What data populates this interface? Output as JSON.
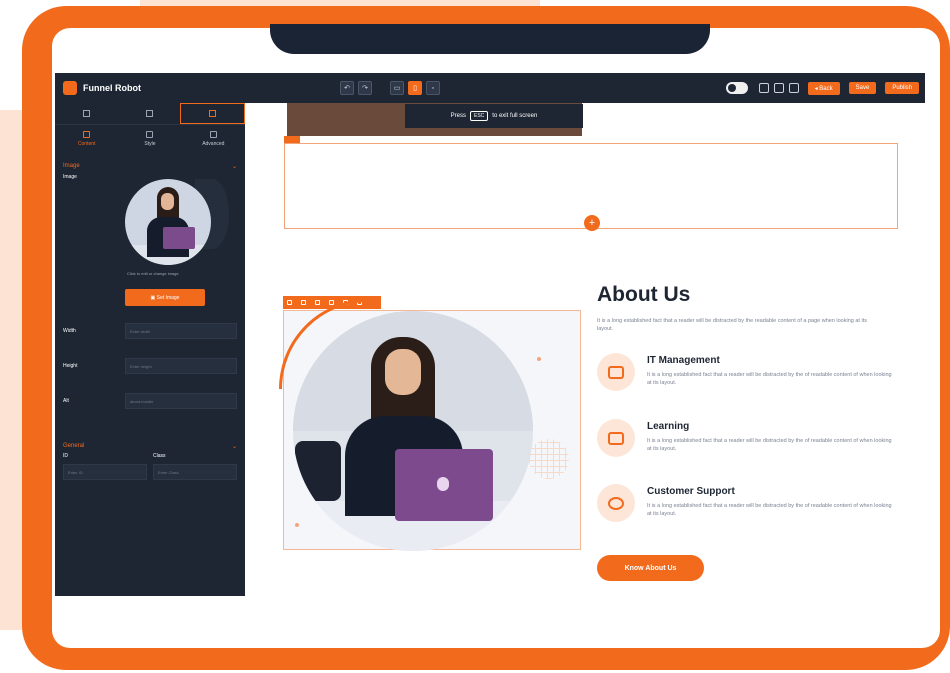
{
  "app": {
    "name": "Funnel Robot"
  },
  "toolbar": {
    "undo_label": "↶",
    "redo_label": "↷",
    "back_label": "◂ Back",
    "save_label": "Save",
    "publish_label": "Publish"
  },
  "sidebar": {
    "sub_tabs": [
      "Content",
      "Style",
      "Advanced"
    ],
    "image_section": "Image",
    "image_label": "Image",
    "caption": "Click to edit or change image",
    "set_image_label": "Set Image",
    "fields": [
      {
        "label": "Width",
        "placeholder": "Enter width"
      },
      {
        "label": "Height",
        "placeholder": "Enter height"
      },
      {
        "label": "Alt",
        "placeholder": "about-bundle"
      }
    ],
    "general_section": "General",
    "general_fields": [
      {
        "label": "ID",
        "placeholder": "Enter ID"
      },
      {
        "label": "Class",
        "placeholder": "Enter Class"
      }
    ]
  },
  "canvas": {
    "tooltip_pre": "Press",
    "tooltip_key": "ESC",
    "tooltip_post": "to exit full screen"
  },
  "about": {
    "title": "About Us",
    "description": "It is a long established fact that a reader will be distracted by the readable content of a page when looking at its layout.",
    "features": [
      {
        "icon": "laptop-icon",
        "title": "IT Management",
        "desc": "It is a long established fact that a reader will be distracted by the of readable content of when looking at its layout."
      },
      {
        "icon": "book-icon",
        "title": "Learning",
        "desc": "It is a long established fact that a reader will be distracted by the of readable content of when looking at its layout."
      },
      {
        "icon": "headset-icon",
        "title": "Customer Support",
        "desc": "It is a long established fact that a reader will be distracted by the of readable content of when looking at its layout."
      }
    ],
    "cta_label": "Know About Us"
  },
  "colors": {
    "accent": "#f26b1d",
    "dark": "#1e2633",
    "light_accent": "#fde6d8"
  }
}
